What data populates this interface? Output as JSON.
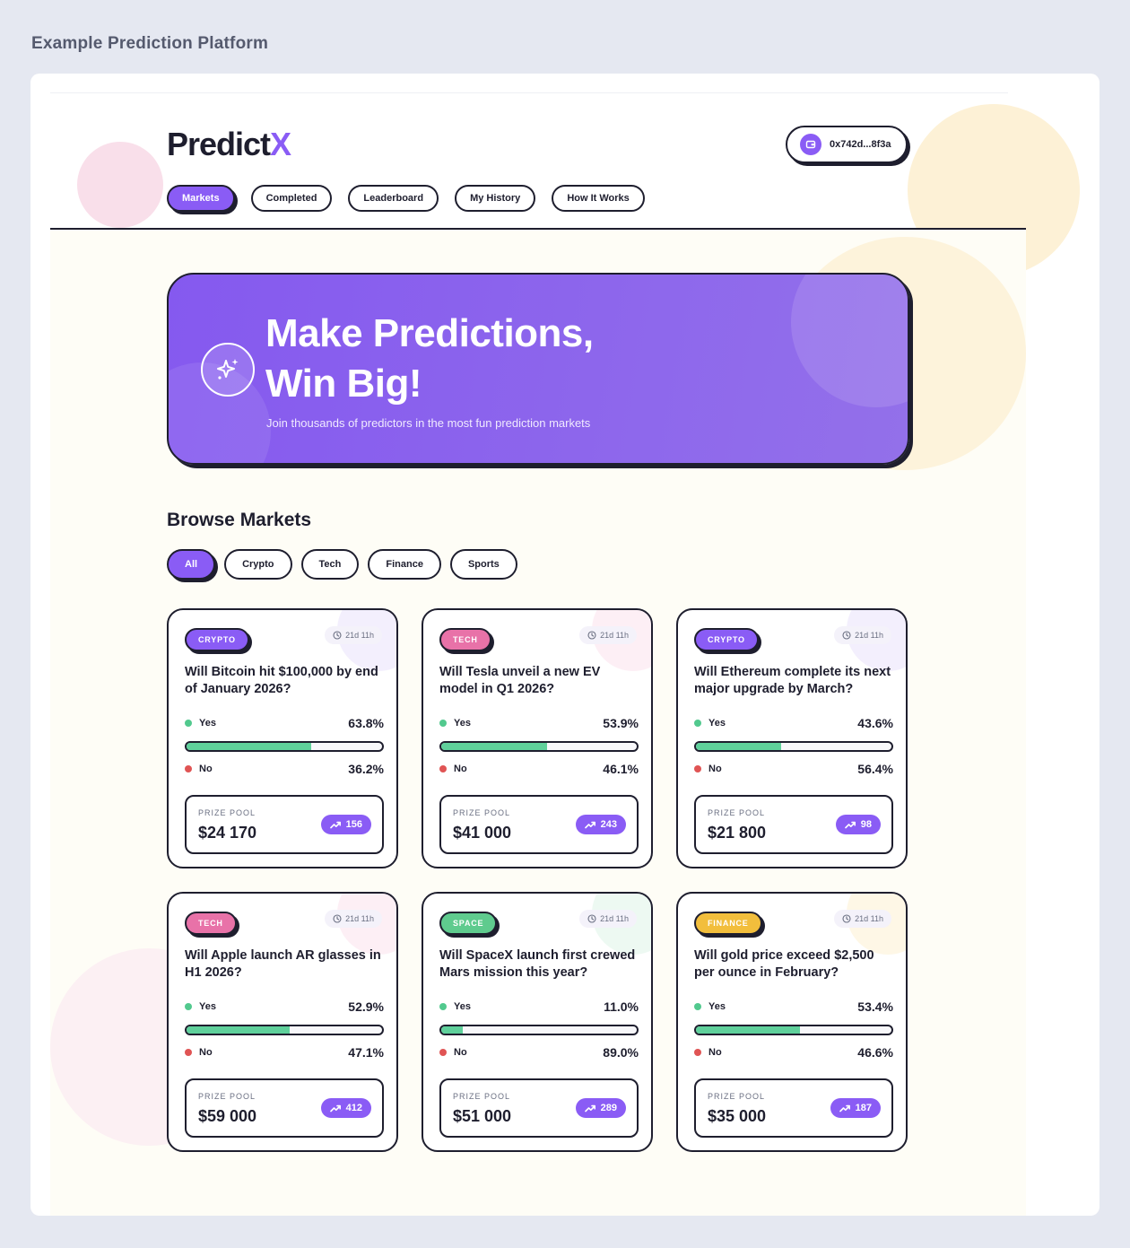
{
  "page_caption": "Example Prediction Platform",
  "logo": {
    "text": "Predict",
    "accent": "X"
  },
  "wallet": {
    "address": "0x742d...8f3a",
    "icon": "wallet-icon"
  },
  "nav": {
    "items": [
      {
        "label": "Markets",
        "active": true
      },
      {
        "label": "Completed",
        "active": false
      },
      {
        "label": "Leaderboard",
        "active": false
      },
      {
        "label": "My History",
        "active": false
      },
      {
        "label": "How It Works",
        "active": false
      }
    ]
  },
  "hero": {
    "title_line1": "Make Predictions,",
    "title_line2": "Win Big!",
    "subtitle": "Join thousands of predictors in the most fun prediction markets",
    "icon": "sparkles-icon"
  },
  "browse": {
    "title": "Browse Markets",
    "filters": [
      {
        "label": "All",
        "active": true
      },
      {
        "label": "Crypto",
        "active": false
      },
      {
        "label": "Tech",
        "active": false
      },
      {
        "label": "Finance",
        "active": false
      },
      {
        "label": "Sports",
        "active": false
      }
    ]
  },
  "colors": {
    "brand": "#8a5cf5",
    "ink": "#1e1e2e",
    "yes": "#52c98e",
    "no": "#e05454",
    "crypto": "#8a5cf5",
    "tech": "#e872a8",
    "space": "#5fcb8e",
    "finance": "#f2be3c"
  },
  "markets": [
    {
      "category": "CRYPTO",
      "category_color": "#8a5cf5",
      "deco_color": "#e4dcfb",
      "timer": "21d 11h",
      "question": "Will Bitcoin hit $100,000 by end of January 2026?",
      "yes_label": "Yes",
      "yes_pct": "63.8%",
      "yes_fraction": 0.638,
      "no_label": "No",
      "no_pct": "36.2%",
      "pool_label": "PRIZE POOL",
      "pool_value": "$24 170",
      "count": "156"
    },
    {
      "category": "TECH",
      "category_color": "#e872a8",
      "deco_color": "#fbdbe8",
      "timer": "21d 11h",
      "question": "Will Tesla unveil a new EV model in Q1 2026?",
      "yes_label": "Yes",
      "yes_pct": "53.9%",
      "yes_fraction": 0.539,
      "no_label": "No",
      "no_pct": "46.1%",
      "pool_label": "PRIZE POOL",
      "pool_value": "$41 000",
      "count": "243"
    },
    {
      "category": "CRYPTO",
      "category_color": "#8a5cf5",
      "deco_color": "#e4dcfb",
      "timer": "21d 11h",
      "question": "Will Ethereum complete its next major upgrade by March?",
      "yes_label": "Yes",
      "yes_pct": "43.6%",
      "yes_fraction": 0.436,
      "no_label": "No",
      "no_pct": "56.4%",
      "pool_label": "PRIZE POOL",
      "pool_value": "$21 800",
      "count": "98"
    },
    {
      "category": "TECH",
      "category_color": "#e872a8",
      "deco_color": "#fbdbe8",
      "timer": "21d 11h",
      "question": "Will Apple launch AR glasses in H1 2026?",
      "yes_label": "Yes",
      "yes_pct": "52.9%",
      "yes_fraction": 0.529,
      "no_label": "No",
      "no_pct": "47.1%",
      "pool_label": "PRIZE POOL",
      "pool_value": "$59 000",
      "count": "412"
    },
    {
      "category": "SPACE",
      "category_color": "#5fcb8e",
      "deco_color": "#d6f2e3",
      "timer": "21d 11h",
      "question": "Will SpaceX launch first crewed Mars mission this year?",
      "yes_label": "Yes",
      "yes_pct": "11.0%",
      "yes_fraction": 0.11,
      "no_label": "No",
      "no_pct": "89.0%",
      "pool_label": "PRIZE POOL",
      "pool_value": "$51 000",
      "count": "289"
    },
    {
      "category": "FINANCE",
      "category_color": "#f2be3c",
      "deco_color": "#fdeec8",
      "timer": "21d 11h",
      "question": "Will gold price exceed $2,500 per ounce in February?",
      "yes_label": "Yes",
      "yes_pct": "53.4%",
      "yes_fraction": 0.534,
      "no_label": "No",
      "no_pct": "46.6%",
      "pool_label": "PRIZE POOL",
      "pool_value": "$35 000",
      "count": "187"
    }
  ]
}
